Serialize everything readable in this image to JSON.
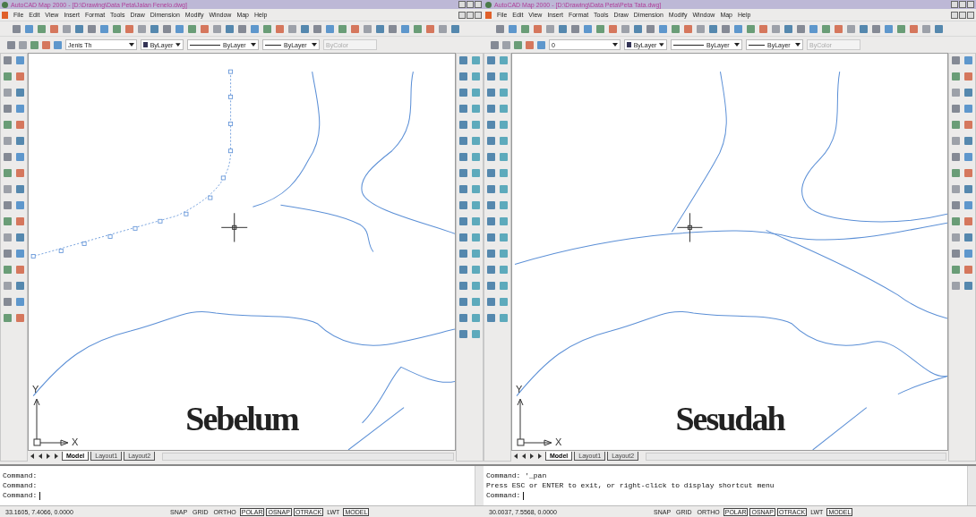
{
  "windows": [
    {
      "title": "AutoCAD Map 2000 - [D:\\Drawing\\Data Peta\\Jalan Fenelo.dwg]",
      "menu": [
        "File",
        "Edit",
        "View",
        "Insert",
        "Format",
        "Tools",
        "Draw",
        "Dimension",
        "Modify",
        "Window",
        "Map",
        "Help"
      ],
      "layer": "Jenis Th",
      "color_control": "ByLayer",
      "linetype": "ByLayer",
      "lineweight": "ByLayer",
      "plot_style": "ByColor",
      "axis_y": "Y",
      "axis_x": "X",
      "caption": "Sebelum",
      "tabs": [
        {
          "label": "Model",
          "selected": true
        },
        {
          "label": "Layout1",
          "selected": false
        },
        {
          "label": "Layout2",
          "selected": false
        }
      ],
      "command_lines": [
        "Command:",
        "Command:",
        "Command:"
      ],
      "coordinates": "33.1605, 7.4066, 0.0000",
      "status": [
        {
          "label": "SNAP",
          "on": false
        },
        {
          "label": "GRID",
          "on": false
        },
        {
          "label": "ORTHO",
          "on": false
        },
        {
          "label": "POLAR",
          "on": true
        },
        {
          "label": "OSNAP",
          "on": true
        },
        {
          "label": "OTRACK",
          "on": true
        },
        {
          "label": "LWT",
          "on": false
        },
        {
          "label": "MODEL",
          "on": true
        }
      ]
    },
    {
      "title": "AutoCAD Map 2000 - [D:\\Drawing\\Data Peta\\Peta Tata.dwg]",
      "menu": [
        "File",
        "Edit",
        "View",
        "Insert",
        "Format",
        "Tools",
        "Draw",
        "Dimension",
        "Modify",
        "Window",
        "Map",
        "Help"
      ],
      "layer": "0",
      "color_control": "ByLayer",
      "linetype": "ByLayer",
      "lineweight": "ByLayer",
      "plot_style": "ByColor",
      "axis_y": "Y",
      "axis_x": "X",
      "caption": "Sesudah",
      "tabs": [
        {
          "label": "Model",
          "selected": true
        },
        {
          "label": "Layout1",
          "selected": false
        },
        {
          "label": "Layout2",
          "selected": false
        }
      ],
      "command_lines": [
        "Command: '_pan",
        "Press ESC or ENTER to exit, or right-click to display shortcut menu",
        "Command:"
      ],
      "coordinates": "30.0037, 7.5568, 0.0000",
      "status": [
        {
          "label": "SNAP",
          "on": false
        },
        {
          "label": "GRID",
          "on": false
        },
        {
          "label": "ORTHO",
          "on": false
        },
        {
          "label": "POLAR",
          "on": true
        },
        {
          "label": "OSNAP",
          "on": true
        },
        {
          "label": "OTRACK",
          "on": true
        },
        {
          "label": "LWT",
          "on": false
        },
        {
          "label": "MODEL",
          "on": true
        }
      ]
    }
  ]
}
